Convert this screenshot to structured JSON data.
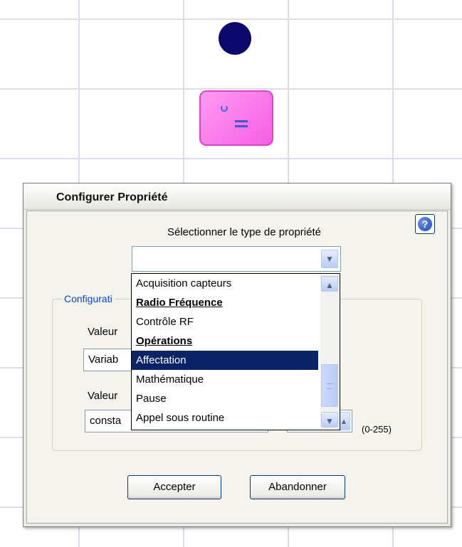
{
  "dialog": {
    "title": "Configurer Propriété",
    "help_icon": "help-question-icon",
    "type_label": "Sélectionner le type de propriété",
    "type_value": "",
    "config_legend": "Configurati",
    "value1_label": "Valeur",
    "value1_field": "Variab",
    "value2_label": "Valeur",
    "value2_field": "consta",
    "range_label": "(0-255)",
    "accept_label": "Accepter",
    "cancel_label": "Abandonner"
  },
  "dropdown": {
    "options": [
      {
        "label": "Acquisition capteurs",
        "kind": "item"
      },
      {
        "label": "Radio Fréquence",
        "kind": "header"
      },
      {
        "label": "Contrôle RF",
        "kind": "item"
      },
      {
        "label": "Opérations",
        "kind": "header"
      },
      {
        "label": "Affectation",
        "kind": "item",
        "selected": true
      },
      {
        "label": "Mathématique",
        "kind": "item"
      },
      {
        "label": "Pause",
        "kind": "item"
      },
      {
        "label": "Appel sous routine",
        "kind": "item"
      }
    ]
  },
  "colors": {
    "accent": "#0a246a",
    "node_circle": "#0a0a6e",
    "node_box": "#f65de4",
    "legend_text": "#0046d5"
  },
  "icons": {
    "combo_arrow": "chevron-down-icon",
    "scroll_up": "chevron-up-icon",
    "scroll_down": "chevron-down-icon"
  }
}
